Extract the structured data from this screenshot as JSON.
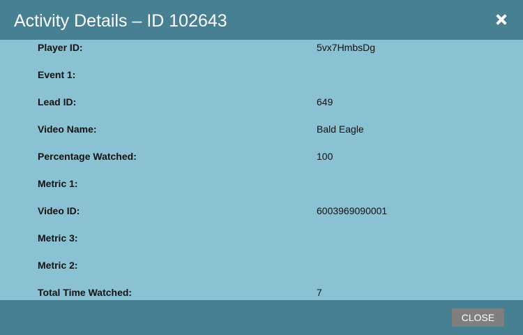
{
  "dialog": {
    "title": "Activity Details – ID 102643",
    "close_icon": "close-icon",
    "close_button_label": "CLOSE"
  },
  "details": [
    {
      "label": "Player ID:",
      "value": "5vx7HmbsDg"
    },
    {
      "label": "Event 1:",
      "value": ""
    },
    {
      "label": "Lead ID:",
      "value": "649"
    },
    {
      "label": "Video Name:",
      "value": "Bald Eagle"
    },
    {
      "label": "Percentage Watched:",
      "value": "100"
    },
    {
      "label": "Metric 1:",
      "value": ""
    },
    {
      "label": "Video ID:",
      "value": "6003969090001"
    },
    {
      "label": "Metric 3:",
      "value": ""
    },
    {
      "label": "Metric 2:",
      "value": ""
    },
    {
      "label": "Total Time Watched:",
      "value": "7"
    }
  ],
  "colors": {
    "header_footer": "#478093",
    "body": "#8ac2d3",
    "button": "#7f7f7f"
  }
}
